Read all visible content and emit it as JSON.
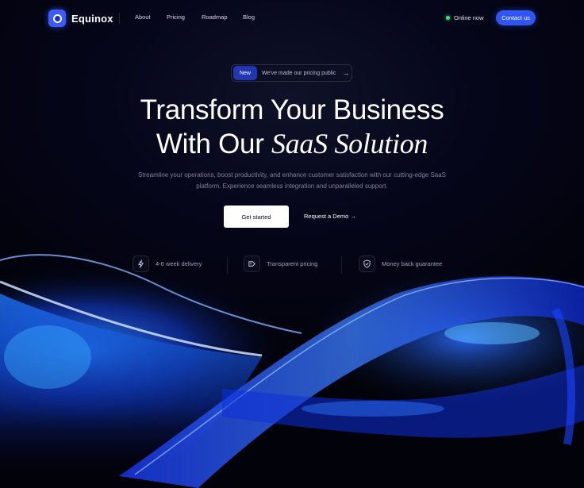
{
  "brand": {
    "name": "Equinox"
  },
  "nav": {
    "links": [
      "About",
      "Pricing",
      "Roadmap",
      "Blog"
    ],
    "status_label": "Online now",
    "contact_label": "Contact us"
  },
  "announcement": {
    "badge": "New",
    "text": "We've made our pricing public",
    "arrow": "→"
  },
  "hero": {
    "title_line1": "Transform Your Business",
    "title_line2_plain": "With Our ",
    "title_line2_italic": "SaaS Solution",
    "subtitle": "Streamline your operations, boost productivity, and enhance customer satisfaction with our cutting-edge SaaS platform. Experience seamless integration and unparalleled support.",
    "primary_cta": "Get started",
    "secondary_cta": "Request a Demo →"
  },
  "features": [
    {
      "icon": "bolt-icon",
      "label": "4-6 week delivery"
    },
    {
      "icon": "tag-icon",
      "label": "Transparent pricing"
    },
    {
      "icon": "shield-check-icon",
      "label": "Money back guarantee"
    }
  ],
  "colors": {
    "accent": "#2f55f5",
    "background": "#02020a",
    "status": "#3ee07a"
  }
}
